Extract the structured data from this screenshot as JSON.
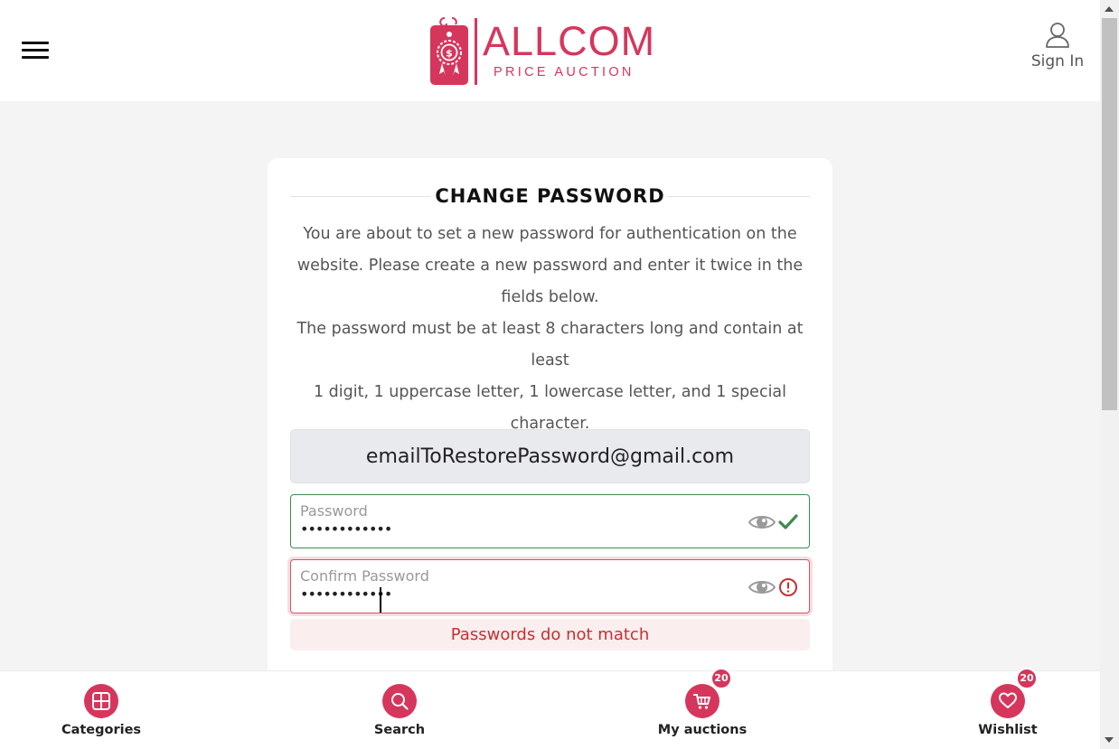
{
  "header": {
    "menu_icon": "hamburger-menu-icon",
    "logo": {
      "name": "ALLCOM",
      "subtitle": "PRICE AUCTION",
      "icon": "price-tag-dollar-icon",
      "color": "#d6365c"
    },
    "sign_in": {
      "label": "Sign In",
      "icon": "user-icon"
    }
  },
  "form": {
    "title": "CHANGE PASSWORD",
    "intro_lines": [
      "You are about to set a new password for authentication on the",
      "website. Please create a new password and enter it twice in the",
      "fields below.",
      "The password must be at least 8 characters long and contain at least",
      "1 digit, 1 uppercase letter, 1 lowercase letter, and 1 special",
      "character."
    ],
    "email": "emailToRestorePassword@gmail.com",
    "password": {
      "label": "Password",
      "value": "••••••••••••",
      "status": "valid",
      "status_icon": "checkmark-icon",
      "status_color": "#3f8a4e"
    },
    "confirm_password": {
      "label": "Confirm Password",
      "value": "••••••••••••",
      "status": "invalid",
      "status_icon": "error-circle-icon",
      "status_color": "#c53030"
    },
    "error_message": "Passwords do not match"
  },
  "bottom_nav": {
    "accent_color": "#d6365c",
    "items": [
      {
        "label": "Categories",
        "icon": "grid-icon"
      },
      {
        "label": "Search",
        "icon": "search-icon"
      },
      {
        "label": "My auctions",
        "icon": "cart-icon",
        "badge": "20"
      },
      {
        "label": "Wishlist",
        "icon": "heart-icon",
        "badge": "20"
      }
    ]
  }
}
